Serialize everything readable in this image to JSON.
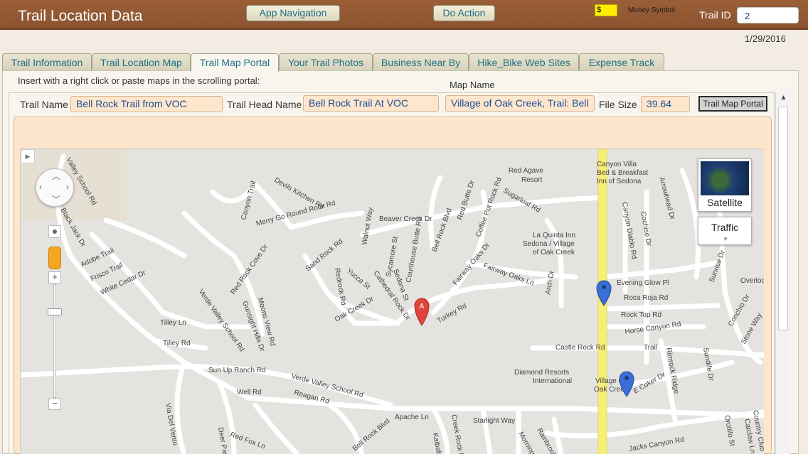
{
  "header": {
    "app_title": "Trail Location Data",
    "nav_button": "App Navigation",
    "action_button": "Do Action",
    "money_value": "$",
    "money_label": "Money Symbol",
    "trail_id_label": "Trail ID",
    "trail_id_value": "2",
    "date": "1/29/2016"
  },
  "tabs": [
    {
      "label": "Trail Information"
    },
    {
      "label": "Trail Location Map"
    },
    {
      "label": "Trail Map Portal",
      "active": true
    },
    {
      "label": "Your Trail Photos"
    },
    {
      "label": "Business Near By"
    },
    {
      "label": "Hike_Bike Web Sites"
    },
    {
      "label": "Expense Track"
    }
  ],
  "portal": {
    "instruction": "Insert with a right click or paste maps in the scrolling portal:",
    "map_name_label": "Map Name",
    "trail_name_label": "Trail Name",
    "trail_name": "Bell Rock Trail from VOC",
    "trail_head_label": "Trail Head Name",
    "trail_head_name": "Bell Rock Trail At VOC",
    "map_name": "Village of Oak Creek, Trail: Bell",
    "file_size_label": "File Size",
    "file_size": "39.64",
    "portal_button": "Trail Map Portal"
  },
  "map": {
    "satellite_label": "Satellite",
    "traffic_label": "Traffic",
    "marker_a": "A",
    "street_labels": [
      "Valley School Rd",
      "Canyon Trail",
      "Devils Kitchen Rd",
      "Merry Go Round Rock Rd",
      "Beaver Creek Dr",
      "Red Butte Dr",
      "Sugarloaf Rd",
      "Red Agave Resort",
      "Canyon Villa Bed & Breakfast Inn of Sedona",
      "Arrowhead Dr",
      "Black Jack Dr",
      "Coffee Pot Rock Rd",
      "Bell Rock Blvd",
      "Walnut Way",
      "Sand Rock Rd",
      "Red Rock Cove Dr",
      "Adobe Trail",
      "Frisco Trail",
      "White Cedar Dr",
      "La Quinta Inn Sedona / Village of Oak Creek",
      "Canyon Diablo Rd",
      "Cochise Dr",
      "Sycamore St",
      "Courthouse Butte Rd",
      "Fairway Oaks Dr",
      "Fairway Oaks Ln",
      "Arch Dr",
      "Redrock Rd",
      "Yucca St",
      "Cathedral Rock Dr",
      "Sedona St",
      "Evening Glow Pl",
      "Roca Roja Rd",
      "Oak Creek Dr",
      "Turkey Rd",
      "Verde Valley School Rd",
      "Gunsight Hills Dr",
      "Moons View Rd",
      "Rock Top Rd",
      "Horse Canyon Rd",
      "Tilley Ln",
      "Tilley Rd",
      "Castle Rock Rd",
      "Trail",
      "Rimrock Ridge",
      "Sunup Ranch Rd",
      "Well Rd",
      "Diamond Resorts International",
      "Village of Oak Creek",
      "E Coker Dr",
      "Reagan Rd",
      "Apache Ln",
      "Starlight Way",
      "Via Del Vento",
      "Deer Pass",
      "Red Fox Ln",
      "Kaibab Trail",
      "Creek Rock Rd",
      "Jacks Canyon Rd",
      "Sunrise Dr",
      "Sundife Dr",
      "Conchio Dr",
      "Stone Way",
      "Overlook",
      "Country Club",
      "Catclaw Ln",
      "Orotillo St",
      "Morning Sky",
      "Rainbrook Rd",
      "Bell Rock Blvd"
    ]
  }
}
